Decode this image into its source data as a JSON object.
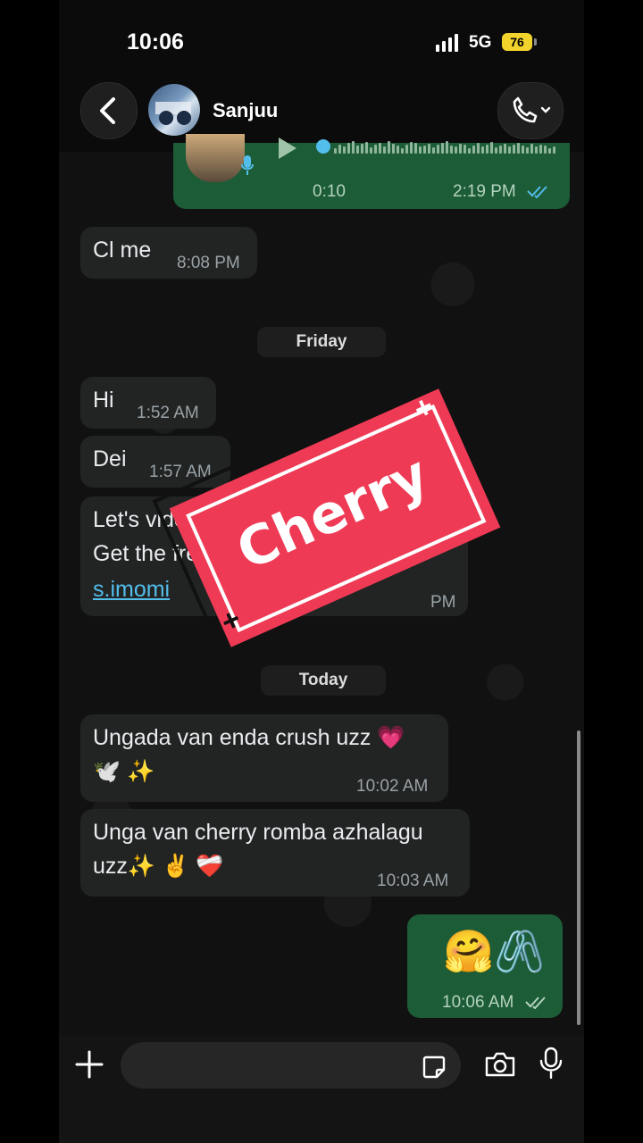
{
  "status_bar": {
    "time": "10:06",
    "network": "5G",
    "battery": "76"
  },
  "header": {
    "contact_name": "Sanjuu"
  },
  "messages": [
    {
      "type": "voice",
      "duration": "0:10",
      "time": "2:19 PM"
    },
    {
      "type": "incoming",
      "text": "Cl me",
      "time": "8:08 PM"
    },
    {
      "type": "date",
      "text": "Friday"
    },
    {
      "type": "incoming",
      "text": "Hi",
      "time": "1:52 AM"
    },
    {
      "type": "incoming",
      "text": "Dei",
      "time": "1:57 AM"
    },
    {
      "type": "incoming",
      "line1": "Let's video chat o",
      "line2": "Get the free",
      "link": "s.imomi",
      "time": "PM"
    },
    {
      "type": "date",
      "text": "Today"
    },
    {
      "type": "incoming",
      "line1": "Ungada van enda crush uzz 💗",
      "line2": "🕊️ ✨",
      "time": "10:02 AM"
    },
    {
      "type": "incoming",
      "line1": "Unga van cherry romba azhalagu",
      "line2": "uzz✨ ✌️ ❤️‍🩹",
      "time": "10:03 AM"
    },
    {
      "type": "outgoing",
      "text": "🤗🖇️",
      "time": "10:06 AM"
    }
  ],
  "sticker": {
    "text": "Cherry"
  },
  "input": {
    "placeholder": ""
  },
  "colors": {
    "incoming_bubble": "#222424",
    "outgoing_bubble": "#1c5c37",
    "sticker_red": "#ef3a55",
    "read_ticks": "#53bdeb",
    "battery": "#f2d32b"
  }
}
